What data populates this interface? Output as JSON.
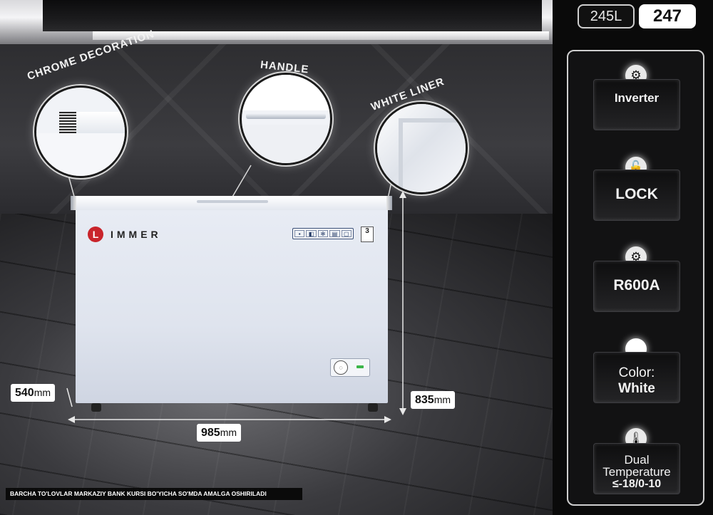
{
  "capacity": {
    "volume_label": "245L",
    "model_number": "247"
  },
  "brand": {
    "name": "IMMER",
    "logo_letter": "L"
  },
  "callouts": [
    {
      "id": "chrome",
      "label": "CHROME DECORATION"
    },
    {
      "id": "handle",
      "label": "HANDLE"
    },
    {
      "id": "liner",
      "label": "WHITE LINER"
    }
  ],
  "dimensions": {
    "depth": {
      "value": "540",
      "unit": "mm"
    },
    "width": {
      "value": "985",
      "unit": "mm"
    },
    "height": {
      "value": "835",
      "unit": "mm"
    }
  },
  "features": [
    {
      "icon": "inverter-icon",
      "glyph": "⚙",
      "lines": [
        "Inverter"
      ]
    },
    {
      "icon": "lock-icon",
      "glyph": "🔓",
      "lines": [
        "LOCK"
      ]
    },
    {
      "icon": "refrigerant-icon",
      "glyph": "⚙",
      "lines": [
        "R600A"
      ]
    },
    {
      "icon": "color-swatch-icon",
      "glyph": "",
      "lines": [
        "Color:",
        "White"
      ]
    },
    {
      "icon": "thermometer-icon",
      "glyph": "🌡",
      "lines": [
        "Dual",
        "Temperature",
        "≤-18/0-10"
      ]
    }
  ],
  "warranty_badge": "3",
  "disclaimer": "BARCHA TO'LOVLAR MARKAZIY BANK KURSI BO'YICHA SO'MDA AMALGA OSHIRILADI",
  "colors": {
    "panel_border": "#cfcfcf",
    "brand_red": "#c9242b",
    "background": "#0a0a0a"
  }
}
